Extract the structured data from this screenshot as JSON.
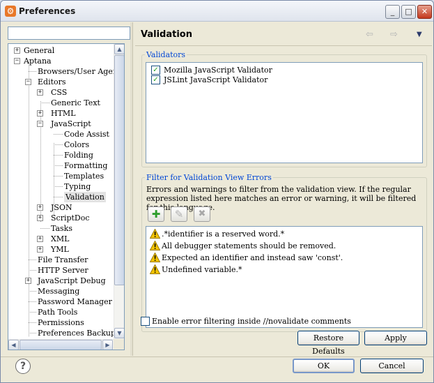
{
  "window": {
    "title": "Preferences"
  },
  "titlebar": {
    "minimize": "_",
    "maximize": "□",
    "close": "✕"
  },
  "search": {
    "value": "",
    "placeholder": ""
  },
  "tree": {
    "items": [
      {
        "label": "General",
        "expander": "+"
      },
      {
        "label": "Aptana",
        "expander": "−"
      },
      {
        "label": "Browsers/User Agents",
        "expander": ""
      },
      {
        "label": "Editors",
        "expander": "−"
      },
      {
        "label": "CSS",
        "expander": "+"
      },
      {
        "label": "Generic Text",
        "expander": ""
      },
      {
        "label": "HTML",
        "expander": "+"
      },
      {
        "label": "JavaScript",
        "expander": "−"
      },
      {
        "label": "Code Assist",
        "expander": ""
      },
      {
        "label": "Colors",
        "expander": ""
      },
      {
        "label": "Folding",
        "expander": ""
      },
      {
        "label": "Formatting",
        "expander": ""
      },
      {
        "label": "Templates",
        "expander": ""
      },
      {
        "label": "Typing",
        "expander": ""
      },
      {
        "label": "Validation",
        "expander": ""
      },
      {
        "label": "JSON",
        "expander": "+"
      },
      {
        "label": "ScriptDoc",
        "expander": "+"
      },
      {
        "label": "Tasks",
        "expander": ""
      },
      {
        "label": "XML",
        "expander": "+"
      },
      {
        "label": "YML",
        "expander": "+"
      },
      {
        "label": "File Transfer",
        "expander": ""
      },
      {
        "label": "HTTP Server",
        "expander": ""
      },
      {
        "label": "JavaScript Debug",
        "expander": "+"
      },
      {
        "label": "Messaging",
        "expander": ""
      },
      {
        "label": "Password Manager",
        "expander": ""
      },
      {
        "label": "Path Tools",
        "expander": ""
      },
      {
        "label": "Permissions",
        "expander": ""
      },
      {
        "label": "Preferences Backup",
        "expander": ""
      }
    ]
  },
  "page": {
    "title": "Validation",
    "nav": {
      "back": "⇦",
      "forward": "⇨",
      "menu": "▼"
    }
  },
  "validators": {
    "label": "Validators",
    "items": [
      {
        "label": "Mozilla JavaScript Validator",
        "checked": true,
        "mark": "✓"
      },
      {
        "label": "JSLint JavaScript Validator",
        "checked": true,
        "mark": "✓"
      }
    ]
  },
  "filter": {
    "label": "Filter for Validation View Errors",
    "description": "Errors and warnings to filter from the validation view. If the regular expression listed here matches an error or warning, it will be filtered for this language.",
    "add_icon": "✚",
    "edit_icon": "✎",
    "delete_icon": "✖",
    "items": [
      ".*identifier is a reserved word.*",
      "All debugger statements should be removed.",
      "Expected an identifier and instead saw 'const'.",
      "Undefined variable.*"
    ]
  },
  "option": {
    "label": "Enable error filtering inside //novalidate comments",
    "checked": false
  },
  "buttons": {
    "restore_defaults": "Restore Defaults",
    "apply": "Apply",
    "ok": "OK",
    "cancel": "Cancel",
    "help": "?"
  },
  "colors": {
    "group_label": "#0046d5",
    "warning": "#f5c400",
    "check": "#21a121"
  }
}
